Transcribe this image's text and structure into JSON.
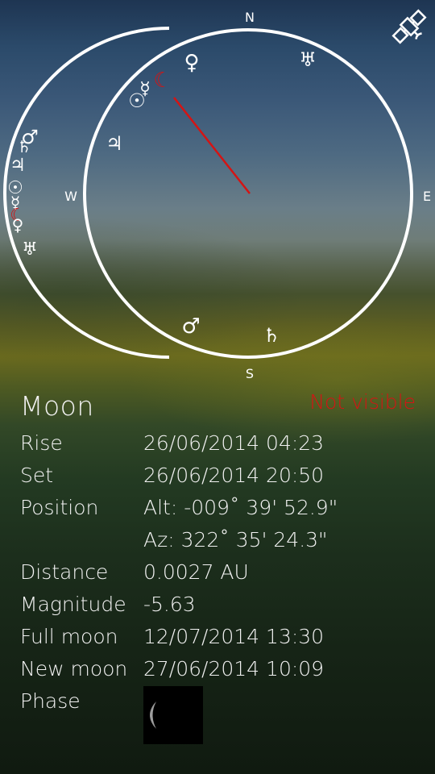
{
  "compass": {
    "north": "N",
    "south": "S",
    "east": "E",
    "west": "W"
  },
  "sky_symbols": {
    "inner": [
      {
        "name": "moon",
        "glyph": "☾",
        "color": "#d41414"
      },
      {
        "name": "venus",
        "glyph": "♀",
        "color": "#ffffff"
      },
      {
        "name": "uranus",
        "glyph": "♅",
        "color": "#ffffff"
      },
      {
        "name": "mercury",
        "glyph": "☿",
        "color": "#ffffff"
      },
      {
        "name": "sun",
        "glyph": "☉",
        "color": "#ffffff"
      },
      {
        "name": "jupiter",
        "glyph": "♃",
        "color": "#ffffff"
      },
      {
        "name": "mars",
        "glyph": "♂",
        "color": "#ffffff"
      },
      {
        "name": "saturn",
        "glyph": "♄",
        "color": "#ffffff"
      }
    ],
    "outer": [
      {
        "name": "mars",
        "glyph": "♂",
        "color": "#ffffff"
      },
      {
        "name": "saturn",
        "glyph": "♄",
        "color": "#ffffff"
      },
      {
        "name": "jupiter",
        "glyph": "♃",
        "color": "#ffffff"
      },
      {
        "name": "sun",
        "glyph": "☉",
        "color": "#ffffff"
      },
      {
        "name": "mercury",
        "glyph": "☿",
        "color": "#ffffff"
      },
      {
        "name": "moon",
        "glyph": "☾",
        "color": "#d41414"
      },
      {
        "name": "venus",
        "glyph": "♀",
        "color": "#ffffff"
      },
      {
        "name": "uranus",
        "glyph": "♅",
        "color": "#ffffff"
      }
    ]
  },
  "satellite_icon": "satellite-icon",
  "details": {
    "title": "Moon",
    "visibility": "Not visible",
    "visibility_color": "#d41414",
    "rows": [
      {
        "label": "Rise",
        "value": "26/06/2014 04:23"
      },
      {
        "label": "Set",
        "value": "26/06/2014 20:50"
      },
      {
        "label": "Position",
        "value": "Alt: -009˚ 39' 52.9\""
      },
      {
        "label": "",
        "value": "Az:  322˚ 35' 24.3\""
      },
      {
        "label": "Distance",
        "value": "0.0027 AU"
      },
      {
        "label": "Magnitude",
        "value": "-5.63"
      },
      {
        "label": "Full moon",
        "value": "12/07/2014 13:30"
      },
      {
        "label": "New moon",
        "value": "27/06/2014 10:09"
      },
      {
        "label": "Phase",
        "value": ""
      }
    ]
  }
}
